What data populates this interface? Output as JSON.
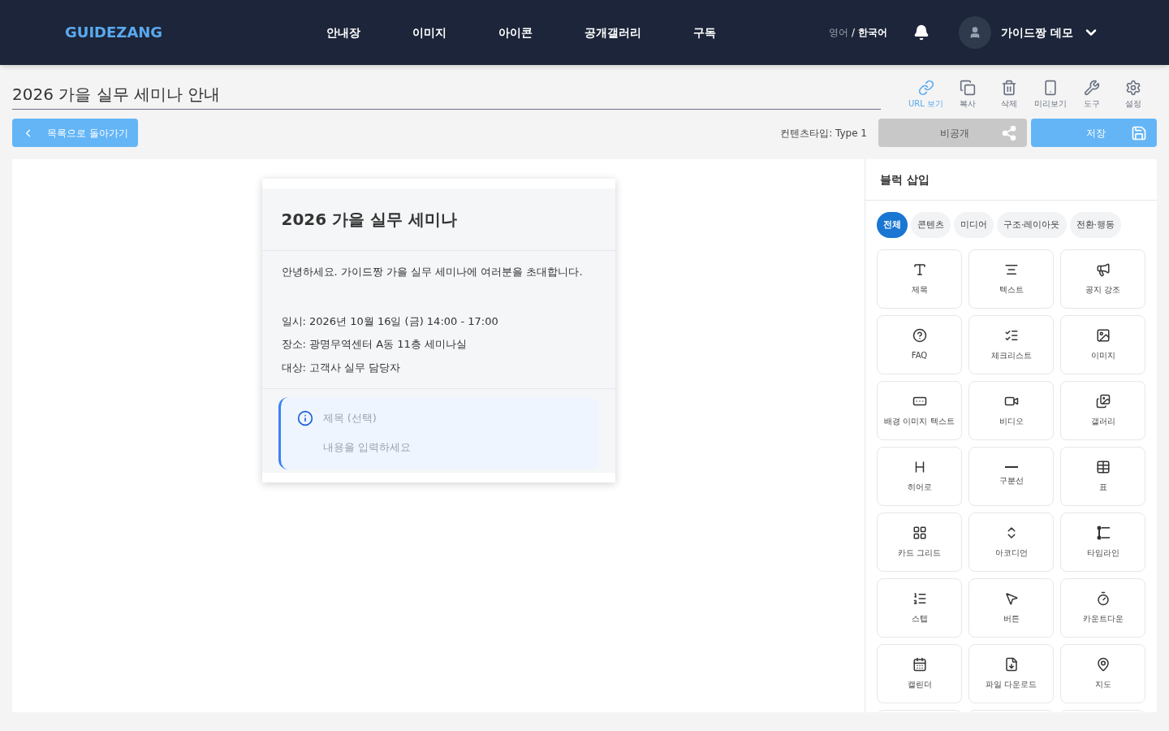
{
  "header": {
    "logo": "GUIDEZANG",
    "nav": [
      {
        "label": "안내장"
      },
      {
        "label": "이미지"
      },
      {
        "label": "아이콘"
      },
      {
        "label": "공개갤러리"
      },
      {
        "label": "구독"
      }
    ],
    "languages": [
      {
        "label": "영어",
        "selected": false
      },
      {
        "label": "한국어",
        "selected": true
      }
    ],
    "language_separator": "/",
    "user": {
      "name": "가이드짱 데모"
    }
  },
  "editor": {
    "title": "2026 가을 실무 세미나 안내",
    "toolbar": [
      {
        "label": "URL 보기",
        "selected": true
      },
      {
        "label": "복사",
        "selected": false
      },
      {
        "label": "삭제",
        "selected": false
      },
      {
        "label": "미리보기",
        "selected": false
      },
      {
        "label": "도구",
        "selected": false
      },
      {
        "label": "설정",
        "selected": false
      }
    ],
    "back_button": "목록으로 돌아가기",
    "content_type": "컨텐츠타입: Type 1",
    "visibility_button": "비공개",
    "save_button": "저장"
  },
  "preview": {
    "heading": "2026 가을 실무 세미나",
    "intro": "안녕하세요. 가이드짱 가을 실무 세미나에 여러분을 초대합니다.",
    "details": [
      "일시: 2026년 10월 16일 (금) 14:00 - 17:00",
      "장소: 광명무역센터 A동 11층 세미나실",
      "대상: 고객사 실무 담당자"
    ],
    "notice": {
      "title_placeholder": "제목 (선택)",
      "body_placeholder": "내용을 입력하세요"
    }
  },
  "block_panel": {
    "title": "블럭 삽입",
    "tabs": [
      {
        "label": "전체",
        "selected": true
      },
      {
        "label": "콘텐츠",
        "selected": false
      },
      {
        "label": "미디어",
        "selected": false
      },
      {
        "label": "구조·레이아웃",
        "selected": false
      },
      {
        "label": "전환·행동",
        "selected": false
      }
    ],
    "blocks": [
      {
        "label": "제목"
      },
      {
        "label": "텍스트"
      },
      {
        "label": "공지 강조"
      },
      {
        "label": "FAQ"
      },
      {
        "label": "체크리스트"
      },
      {
        "label": "이미지"
      },
      {
        "label": "배경 이미지 텍스트"
      },
      {
        "label": "비디오"
      },
      {
        "label": "갤러리"
      },
      {
        "label": "히어로"
      },
      {
        "label": "구분선"
      },
      {
        "label": "표"
      },
      {
        "label": "카드 그리드"
      },
      {
        "label": "아코디언"
      },
      {
        "label": "타임라인"
      },
      {
        "label": "스텝"
      },
      {
        "label": "버튼"
      },
      {
        "label": "카운트다운"
      },
      {
        "label": "캘린더"
      },
      {
        "label": "파일 다운로드"
      },
      {
        "label": "지도"
      }
    ]
  }
}
